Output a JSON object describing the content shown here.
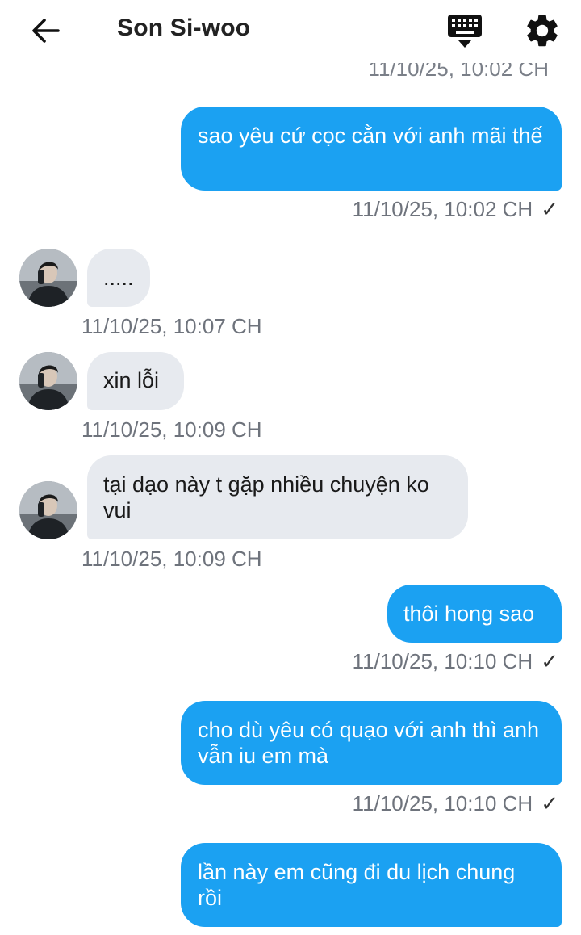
{
  "header": {
    "title": "Son Si-woo",
    "back_icon": "arrow-left-icon",
    "keyboard_icon": "keyboard-icon",
    "settings_icon": "gear-icon"
  },
  "colors": {
    "outgoing_bubble": "#1ba1f2",
    "incoming_bubble": "#e7eaef",
    "timestamp": "#6e737c"
  },
  "partial_timestamp": "11/10/25, 10:02 CH",
  "messages": [
    {
      "direction": "out",
      "text": "sao yêu cứ cọc cằn với anh mãi thế",
      "time": "11/10/25, 10:02 CH",
      "read": "✓"
    },
    {
      "direction": "in",
      "text": ".....",
      "time": "11/10/25, 10:07 CH"
    },
    {
      "direction": "in",
      "text": "xin lỗi",
      "time": "11/10/25, 10:09 CH"
    },
    {
      "direction": "in",
      "text": "tại dạo này t gặp nhiều chuyện ko vui",
      "time": "11/10/25, 10:09 CH"
    },
    {
      "direction": "out",
      "text": "thôi hong sao",
      "time": "11/10/25, 10:10 CH",
      "read": "✓"
    },
    {
      "direction": "out",
      "text": "cho dù yêu có quạo với anh thì anh vẫn iu em mà",
      "time": "11/10/25, 10:10 CH",
      "read": "✓"
    },
    {
      "direction": "out",
      "text": "lần này em cũng đi du lịch chung rồi"
    }
  ]
}
